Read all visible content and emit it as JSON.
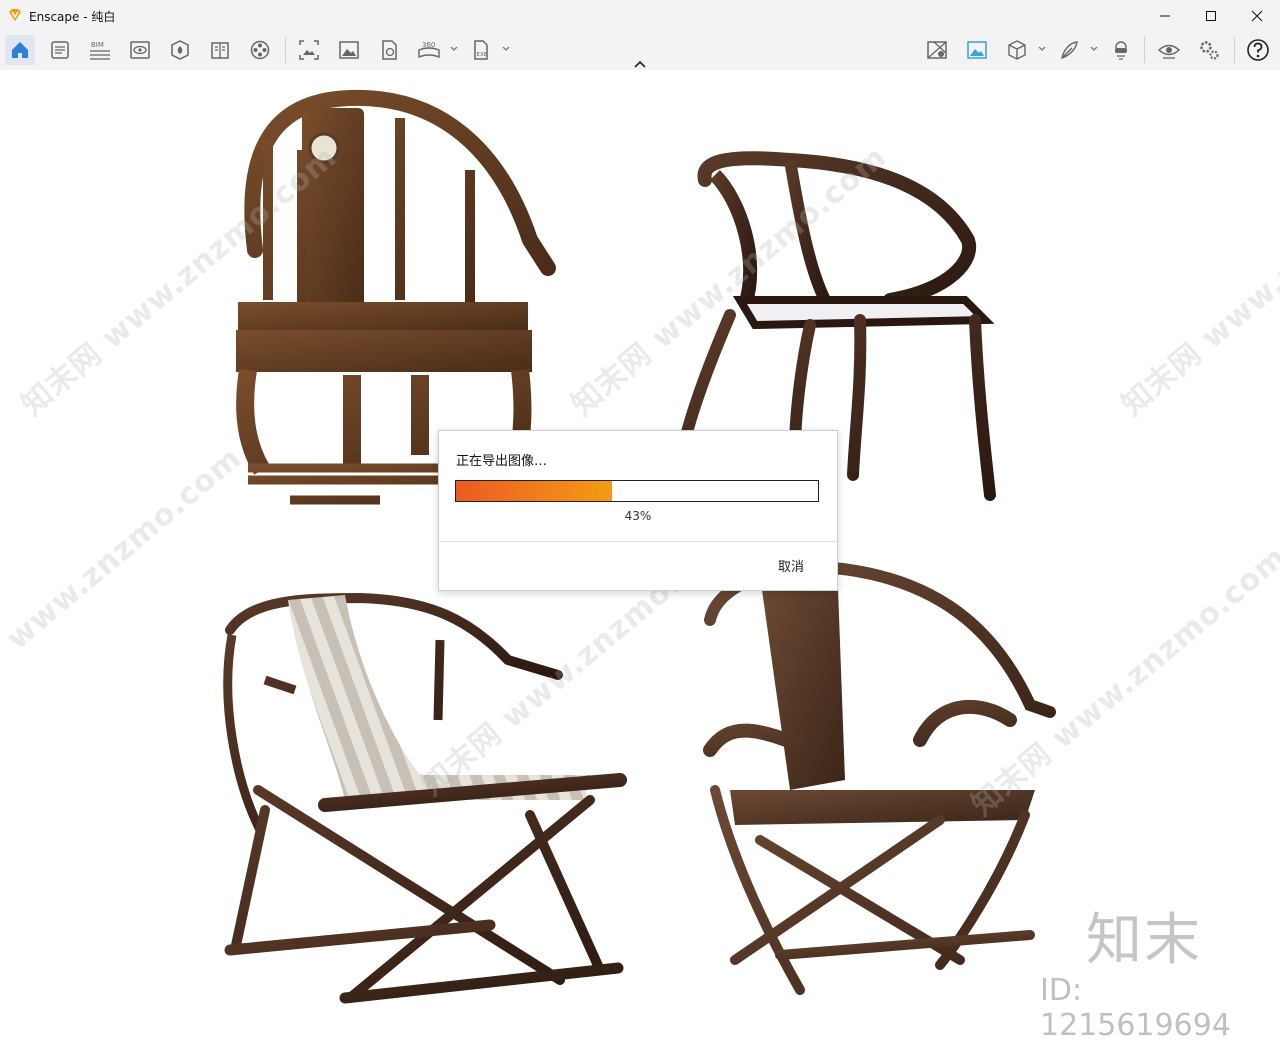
{
  "window": {
    "title": "Enscape - 纯白"
  },
  "dialog": {
    "title": "正在导出图像…",
    "progress_fraction": 0.43,
    "progress_text": "43%",
    "cancel_label": "取消"
  },
  "toolbar": {
    "left_icons": [
      "home-icon",
      "tasks-icon",
      "bim-icon",
      "view-icon",
      "asset-library-icon",
      "material-book-icon",
      "film-reel-icon",
      "screenshot-icon",
      "render-image-icon",
      "batch-render-icon",
      "panorama-360-icon",
      "export-exe-icon"
    ],
    "right_icons": [
      "map-view-icon",
      "image-settings-icon",
      "cube-icon",
      "feather-icon",
      "vr-headset-icon",
      "visibility-icon",
      "settings-icon",
      "help-icon"
    ],
    "bim_text": "BIM",
    "pano_text": "360",
    "exe_text": "EXE"
  },
  "watermark": {
    "brand": "知末",
    "id": "ID: 1215619694",
    "repeat_text": "www.znzmo.com",
    "site_prefix": "知末网"
  },
  "colors": {
    "progress_start": "#ee5a24",
    "progress_end": "#f39c12",
    "active_icon": "#2b7fd6"
  }
}
